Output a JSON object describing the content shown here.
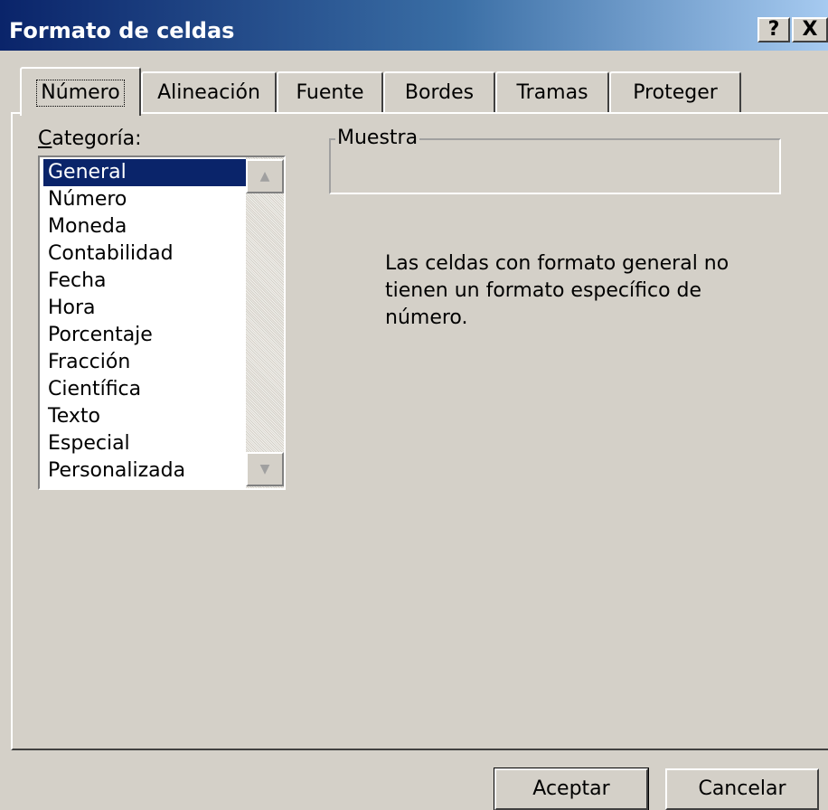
{
  "window": {
    "title": "Formato de celdas",
    "help_label": "?",
    "close_label": "X"
  },
  "tabs": [
    {
      "label": "Número",
      "active": true
    },
    {
      "label": "Alineación"
    },
    {
      "label": "Fuente"
    },
    {
      "label": "Bordes"
    },
    {
      "label": "Tramas"
    },
    {
      "label": "Proteger"
    }
  ],
  "categoria": {
    "label_accesskey": "C",
    "label_rest": "ategoría:",
    "items": [
      "General",
      "Número",
      "Moneda",
      "Contabilidad",
      "Fecha",
      "Hora",
      "Porcentaje",
      "Fracción",
      "Científica",
      "Texto",
      "Especial",
      "Personalizada"
    ],
    "selected": "General"
  },
  "muestra": {
    "legend": "Muestra",
    "value": ""
  },
  "description": "Las celdas con formato general no tienen un formato específico de número.",
  "buttons": {
    "ok": "Aceptar",
    "cancel": "Cancelar"
  }
}
